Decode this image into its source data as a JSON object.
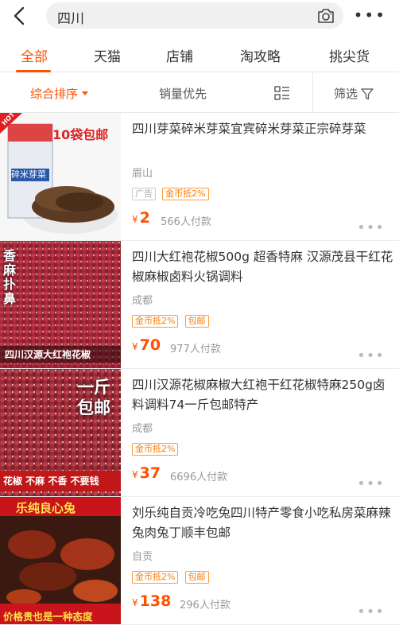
{
  "search": {
    "query": "四川"
  },
  "tabs": [
    {
      "label": "全部"
    },
    {
      "label": "天猫"
    },
    {
      "label": "店铺"
    },
    {
      "label": "淘攻略"
    },
    {
      "label": "挑尖货"
    }
  ],
  "sort": {
    "comprehensive": "综合排序",
    "sales": "销量优先",
    "filter": "筛选"
  },
  "products": [
    {
      "title": "四川芽菜碎米芽菜宜宾碎米芽菜正宗碎芽菜",
      "location": "眉山",
      "tags": [
        "广告",
        "金币抵2%"
      ],
      "price": "2",
      "sales": "566人付款",
      "image_text": [
        "10袋包邮",
        "碎米芽菜"
      ],
      "corner_badge": "HOT"
    },
    {
      "title": "四川大红袍花椒500g 超香特麻 汉源茂县干红花椒麻椒卤料火锅调料",
      "location": "成都",
      "tags": [
        "金币抵2%",
        "包邮"
      ],
      "price": "70",
      "sales": "977人付款",
      "image_text": [
        "香麻扑鼻",
        "四川汉源大红袍花椒"
      ]
    },
    {
      "title": "四川汉源花椒麻椒大红袍干红花椒特麻250g卤料调料74一斤包邮特产",
      "location": "成都",
      "tags": [
        "金币抵2%"
      ],
      "price": "37",
      "sales": "6696人付款",
      "image_text": [
        "一斤包邮",
        "花椒 不麻 不香 不要钱"
      ]
    },
    {
      "title": "刘乐纯自贡冷吃兔四川特产零食小吃私房菜麻辣兔肉兔丁顺丰包邮",
      "location": "自贡",
      "tags": [
        "金币抵2%",
        "包邮"
      ],
      "price": "138",
      "sales": "296人付款",
      "image_text": [
        "乐纯良心兔",
        "价格贵也是一种态度"
      ]
    }
  ],
  "currency_symbol": "¥",
  "colors": {
    "accent": "#ff5000",
    "tag": "#ff7a00"
  }
}
